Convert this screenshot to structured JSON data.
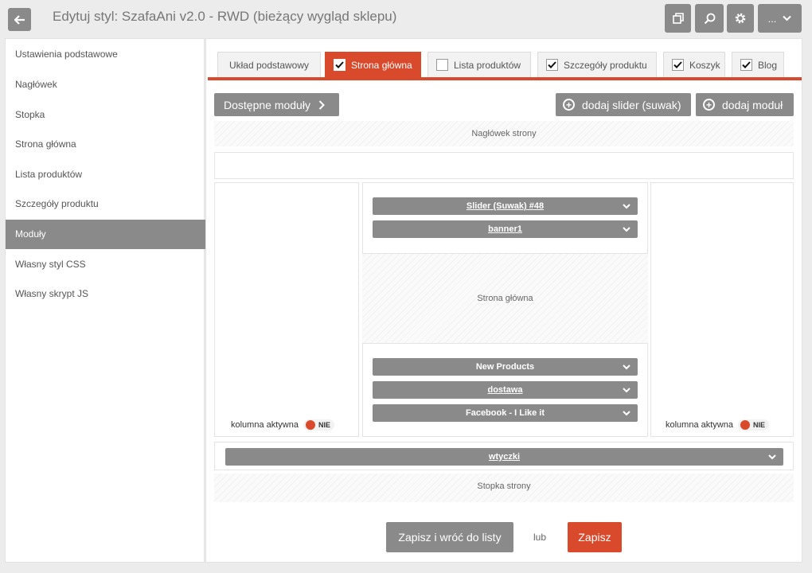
{
  "header": {
    "title": "Edytuj styl: SzafaAni v2.0 - RWD (bieżący wygląd sklepu)",
    "more_label": "...",
    "icons": [
      "back-arrow-icon",
      "copy-icon",
      "search-icon",
      "gear-icon",
      "chevron-down-icon"
    ]
  },
  "sidebar": {
    "items": [
      {
        "label": "Ustawienia podstawowe"
      },
      {
        "label": "Nagłówek"
      },
      {
        "label": "Stopka"
      },
      {
        "label": "Strona główna"
      },
      {
        "label": "Lista produktów"
      },
      {
        "label": "Szczegóły produktu"
      },
      {
        "label": "Moduły",
        "active": true
      },
      {
        "label": "Własny styl CSS"
      },
      {
        "label": "Własny skrypt JS"
      }
    ]
  },
  "tabs": [
    {
      "label": "Układ podstawowy",
      "checkbox": false
    },
    {
      "label": "Strona główna",
      "checkbox": true,
      "checked": true,
      "active": true
    },
    {
      "label": "Lista produktów",
      "checkbox": true,
      "checked": false
    },
    {
      "label": "Szczegóły produktu",
      "checkbox": true,
      "checked": true
    },
    {
      "label": "Koszyk",
      "checkbox": true,
      "checked": true
    },
    {
      "label": "Blog",
      "checkbox": true,
      "checked": true
    }
  ],
  "toolbar": {
    "available_modules": "Dostępne moduły",
    "add_slider": "dodaj slider (suwak)",
    "add_module": "dodaj moduł"
  },
  "layout": {
    "header_zone": "Nagłówek strony",
    "main_zone": "Strona główna",
    "footer_zone": "Stopka strony",
    "top_modules": [
      {
        "label": "Slider (Suwak) #48",
        "underline": true
      },
      {
        "label": "banner1",
        "underline": true
      }
    ],
    "bottom_modules": [
      {
        "label": "New Products",
        "underline": false
      },
      {
        "label": "dostawa",
        "underline": true
      },
      {
        "label": "Facebook - I Like it",
        "underline": false
      }
    ],
    "footer_module": {
      "label": "wtyczki",
      "underline": true
    },
    "left_column": {
      "label": "kolumna aktywna",
      "status": "NIE"
    },
    "right_column": {
      "label": "kolumna aktywna",
      "status": "NIE"
    }
  },
  "actions": {
    "save_back": "Zapisz i wróć do listy",
    "or": "lub",
    "save": "Zapisz"
  },
  "colors": {
    "accent": "#d9492c",
    "button_gray": "#8a8a8a"
  }
}
